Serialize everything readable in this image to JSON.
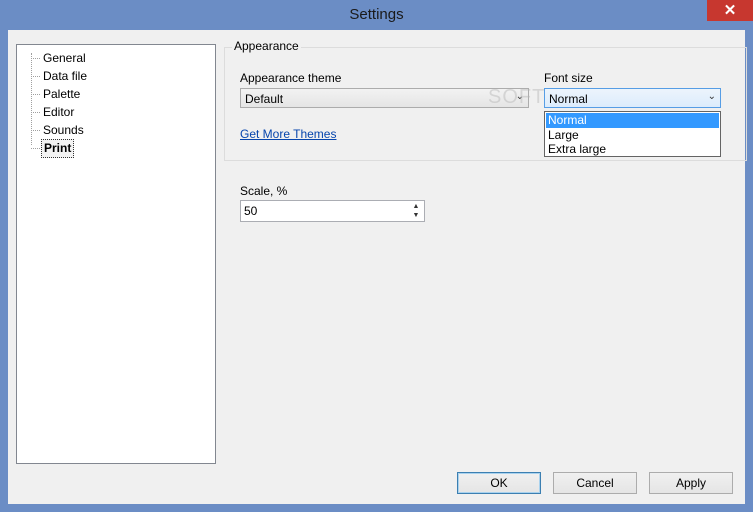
{
  "window": {
    "title": "Settings",
    "close_glyph": "✕"
  },
  "tree": {
    "items": [
      {
        "label": "General"
      },
      {
        "label": "Data file"
      },
      {
        "label": "Palette"
      },
      {
        "label": "Editor"
      },
      {
        "label": "Sounds"
      },
      {
        "label": "Print",
        "selected": true
      }
    ]
  },
  "appearance": {
    "group_label": "Appearance",
    "theme_label": "Appearance theme",
    "theme_value": "Default",
    "font_size_label": "Font size",
    "font_size_value": "Normal",
    "font_size_options": [
      "Normal",
      "Large",
      "Extra large"
    ],
    "highlighted_option": "Normal",
    "more_themes_link": "Get More Themes"
  },
  "scale": {
    "label": "Scale, %",
    "value": "50"
  },
  "buttons": {
    "ok": "OK",
    "cancel": "Cancel",
    "apply": "Apply"
  },
  "watermark": "SOFTPEDIA",
  "colors": {
    "titlebar": "#6b8dc5",
    "close": "#c7372f",
    "highlight": "#3399ff",
    "link": "#0645ad"
  }
}
